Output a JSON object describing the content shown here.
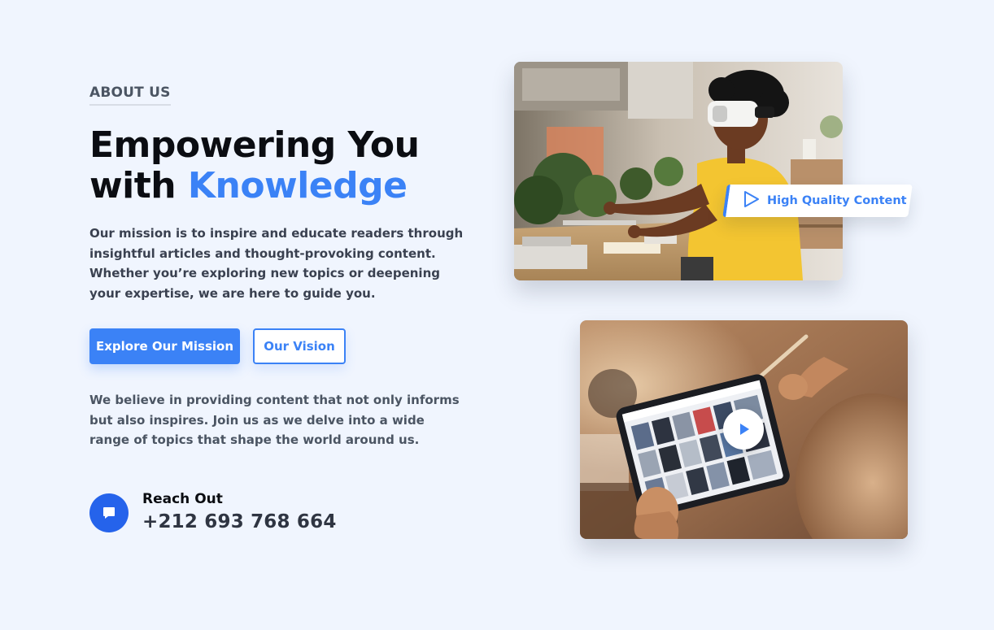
{
  "about": {
    "eyebrow": "ABOUT US",
    "headline_line1": "Empowering You",
    "headline_line2_plain": "with ",
    "headline_line2_accent": "Knowledge",
    "mission": "Our mission is to inspire and educate readers through insightful articles and thought-provoking content. Whether you’re exploring new topics or deepening your expertise, we are here to guide you.",
    "belief": "We believe in providing content that not only informs but also inspires. Join us as we delve into a wide range of topics that shape the world around us."
  },
  "buttons": {
    "primary_label": "Explore Our Mission",
    "secondary_label": "Our Vision"
  },
  "contact": {
    "label": "Reach Out",
    "phone": "+212 693 768 664",
    "icon": "chat-bubble-icon"
  },
  "media": {
    "badge_label": "High Quality Content",
    "badge_icon": "play-outline-icon",
    "video_icon": "play-icon"
  },
  "colors": {
    "accent": "#3b82f6",
    "background": "#f0f5fe",
    "contact_icon_bg": "#2563eb"
  }
}
